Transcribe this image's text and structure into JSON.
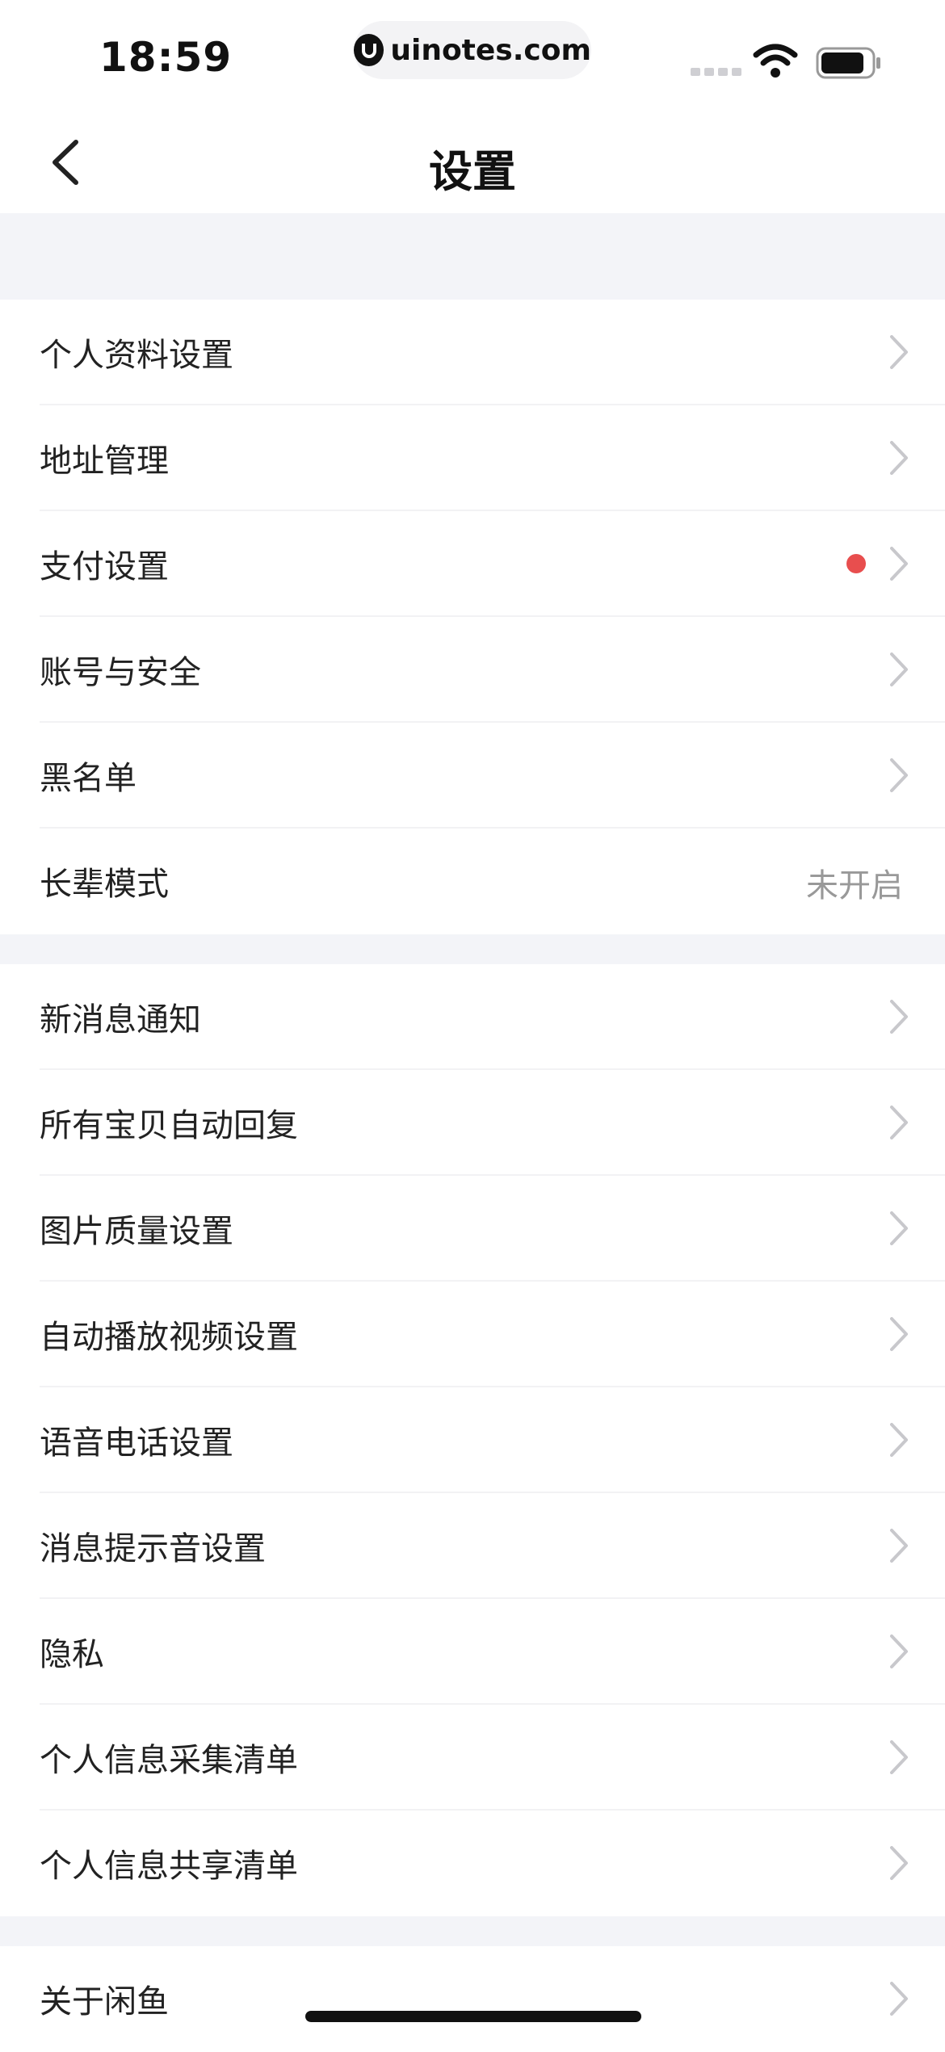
{
  "status": {
    "time": "18:59",
    "url": "uinotes.com"
  },
  "nav": {
    "title": "设置"
  },
  "group1": [
    {
      "label": "个人资料设置"
    },
    {
      "label": "地址管理"
    },
    {
      "label": "支付设置",
      "badge": "red-dot"
    },
    {
      "label": "账号与安全"
    },
    {
      "label": "黑名单"
    },
    {
      "label": "长辈模式",
      "value": "未开启"
    }
  ],
  "group2": [
    {
      "label": "新消息通知"
    },
    {
      "label": "所有宝贝自动回复"
    },
    {
      "label": "图片质量设置"
    },
    {
      "label": "自动播放视频设置"
    },
    {
      "label": "语音电话设置"
    },
    {
      "label": "消息提示音设置"
    },
    {
      "label": "隐私"
    },
    {
      "label": "个人信息采集清单"
    },
    {
      "label": "个人信息共享清单"
    }
  ],
  "group3": [
    {
      "label": "关于闲鱼"
    }
  ],
  "colors": {
    "background_gap": "#f3f4f8",
    "badge_red": "#e84e4e",
    "chevron": "#c8c8cc",
    "value_text": "#999999"
  },
  "icons": [
    "back-chevron-icon",
    "chevron-right-icon",
    "wifi-icon",
    "battery-icon",
    "cellular-signal-icon",
    "uinotes-logo-icon"
  ]
}
